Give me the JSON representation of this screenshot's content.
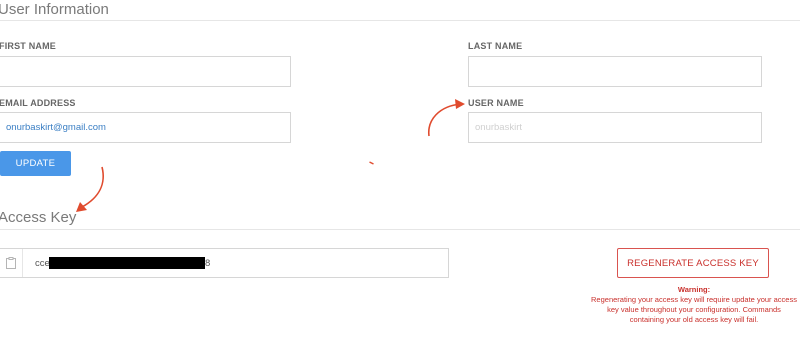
{
  "user_info": {
    "title": "User Information",
    "first_name_label": "FIRST NAME",
    "first_name_value": "",
    "last_name_label": "LAST NAME",
    "last_name_value": "",
    "email_label": "EMAIL ADDRESS",
    "email_value": "onurbaskirt@gmail.com",
    "username_label": "USER NAME",
    "username_value": "onurbaskirt",
    "update_label": "UPDATE"
  },
  "access_key": {
    "title": "Access Key",
    "key_prefix": "cce",
    "key_suffix": "8",
    "copy_icon": "clipboard-icon",
    "regenerate_label": "REGENERATE ACCESS KEY",
    "warning_title": "Warning:",
    "warning_text": "Regenerating your access key will require update your access key value throughout your configuration. Commands containing your old access key will fail."
  },
  "colors": {
    "primary": "#4a97e8",
    "danger": "#c9302c",
    "annotation": "#e04b2e",
    "email_text": "#3b7fc4"
  }
}
